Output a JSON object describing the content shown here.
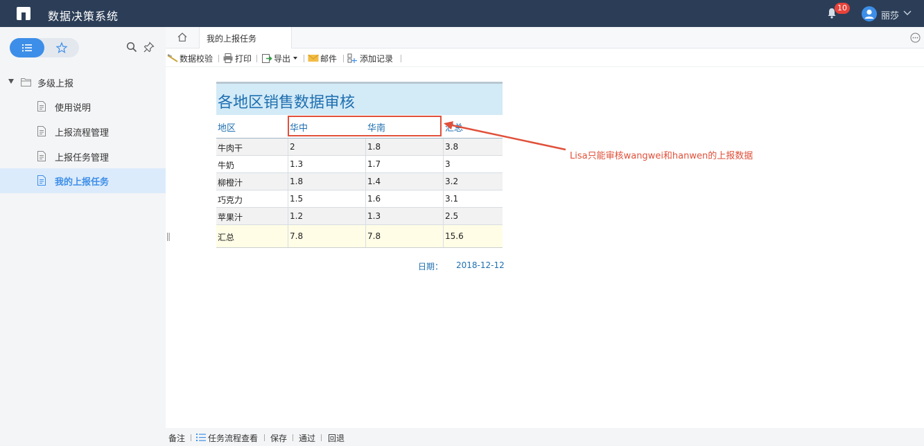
{
  "app": {
    "title": "数据决策系统",
    "notification_count": "10",
    "user_name": "丽莎"
  },
  "sidebar": {
    "root": {
      "label": "多级上报"
    },
    "items": [
      {
        "label": "使用说明"
      },
      {
        "label": "上报流程管理"
      },
      {
        "label": "上报任务管理"
      },
      {
        "label": "我的上报任务"
      }
    ],
    "active_index": 3
  },
  "tabs": {
    "active_label": "我的上报任务"
  },
  "toolbar": {
    "data_check": "数据校验",
    "print": "打印",
    "export": "导出",
    "mail": "邮件",
    "add_record": "添加记录"
  },
  "report": {
    "title": "各地区销售数据审核",
    "headers": [
      "地区",
      "华中",
      "华南",
      "汇总"
    ],
    "rows": [
      [
        "牛肉干",
        "2",
        "1.8",
        "3.8"
      ],
      [
        "牛奶",
        "1.3",
        "1.7",
        "3"
      ],
      [
        "柳橙汁",
        "1.8",
        "1.4",
        "3.2"
      ],
      [
        "巧克力",
        "1.5",
        "1.6",
        "3.1"
      ],
      [
        "苹果汁",
        "1.2",
        "1.3",
        "2.5"
      ]
    ],
    "total": [
      "汇总",
      "7.8",
      "7.8",
      "15.6"
    ],
    "date_label": "日期：",
    "date_value": "2018-12-12"
  },
  "annotation": {
    "text": "Lisa只能审核wangwei和hanwen的上报数据",
    "color": "#e0503a"
  },
  "bottombar": {
    "note": "备注",
    "flow_view": "任务流程查看",
    "save": "保存",
    "pass": "通过",
    "reject": "回退"
  },
  "colors": {
    "header_bg": "#2c3e57",
    "accent": "#3d8ee8",
    "title_bg": "#d3eaf7",
    "report_blue": "#1e6fb0"
  }
}
